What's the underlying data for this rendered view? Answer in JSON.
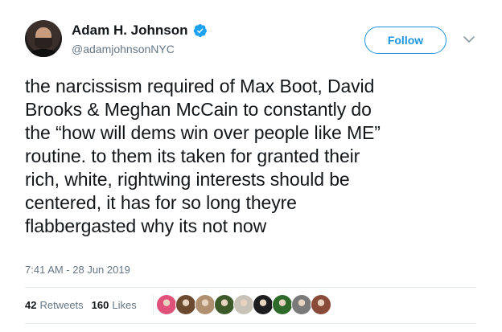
{
  "user": {
    "display_name": "Adam H. Johnson",
    "handle": "@adamjohnsonNYC",
    "verified": true
  },
  "follow_button": {
    "label": "Follow"
  },
  "tweet": {
    "text": "the narcissism required of Max Boot, David\nBrooks & Meghan McCain to constantly do\nthe “how will dems win over people like ME”\nroutine. to them its taken for granted their\nrich, white, rightwing interests should be\ncentered, it has for so long theyre\nflabbergasted why its not now",
    "timestamp": "7:41 AM - 28 Jun 2019"
  },
  "stats": {
    "retweets_count": "42",
    "retweets_label": "Retweets",
    "likes_count": "160",
    "likes_label": "Likes"
  },
  "likers": [
    {
      "color": "#e0527a"
    },
    {
      "color": "#6b4a2f"
    },
    {
      "color": "#b0906e"
    },
    {
      "color": "#3d5a2a"
    },
    {
      "color": "#c9c2b8"
    },
    {
      "color": "#1d1d1f"
    },
    {
      "color": "#2e6b2a"
    },
    {
      "color": "#7a7a7a"
    },
    {
      "color": "#8a4a3a"
    }
  ],
  "colors": {
    "accent": "#1b95e0",
    "text": "#14171a",
    "muted": "#657786"
  }
}
